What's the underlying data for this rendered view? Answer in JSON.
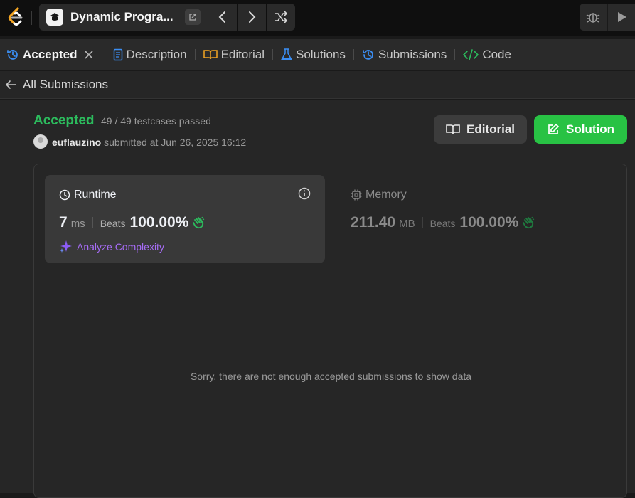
{
  "topbar": {
    "problem_title": "Dynamic Progra...",
    "icons": [
      "leetcode-logo",
      "problem-icon",
      "open-external-icon",
      "chevron-left-icon",
      "chevron-right-icon",
      "shuffle-icon",
      "debug-icon",
      "run-icon"
    ]
  },
  "tabs": [
    {
      "label": "Accepted",
      "icon": "history-icon",
      "active": true
    },
    {
      "label": "Description",
      "icon": "document-icon"
    },
    {
      "label": "Editorial",
      "icon": "book-icon"
    },
    {
      "label": "Solutions",
      "icon": "flask-icon"
    },
    {
      "label": "Submissions",
      "icon": "history-icon"
    },
    {
      "label": "Code",
      "icon": "code-icon"
    }
  ],
  "back": {
    "label": "All Submissions"
  },
  "submission": {
    "status": "Accepted",
    "testcases": "49 / 49 testcases passed",
    "user": "euflauzino",
    "submitted_text": "submitted at Jun 26, 2025 16:12"
  },
  "buttons": {
    "editorial": "Editorial",
    "solution": "Solution"
  },
  "runtime": {
    "title": "Runtime",
    "value": "7",
    "unit": "ms",
    "beats_label": "Beats",
    "beats_pct": "100.00%",
    "analyze": "Analyze Complexity"
  },
  "memory": {
    "title": "Memory",
    "value": "211.40",
    "unit": "MB",
    "beats_label": "Beats",
    "beats_pct": "100.00%"
  },
  "empty_message": "Sorry, there are not enough accepted submissions to show data",
  "colors": {
    "accent_green": "#2cbb5d",
    "solution_button": "#28c244",
    "analyze_purple": "#a66cf5"
  }
}
